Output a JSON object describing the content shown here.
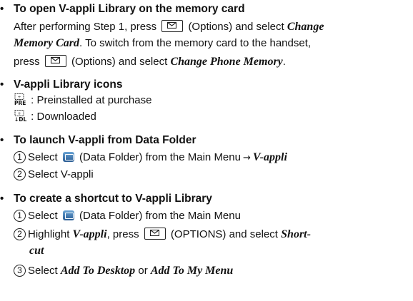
{
  "sections": [
    {
      "bullet": "•",
      "heading": "To open V-appli Library on the memory card",
      "lines": [
        {
          "a": "After performing Step 1, press",
          "b": "(Options) and select",
          "c": "Change"
        },
        {
          "a": "Memory Card",
          "b": ". To switch from the memory card to the handset,"
        },
        {
          "a": "press",
          "b": "(Options) and select",
          "c": "Change Phone Memory",
          "d": "."
        }
      ]
    },
    {
      "bullet": "•",
      "heading": "V-appli Library icons",
      "items": [
        {
          "icon": "preinstalled-icon",
          "badge": "PRE",
          "text": ": Preinstalled at purchase"
        },
        {
          "icon": "downloaded-icon",
          "badge": "↓DL",
          "text": ": Downloaded"
        }
      ]
    },
    {
      "bullet": "•",
      "heading": "To launch V-appli from Data Folder",
      "steps": [
        {
          "num": "1",
          "a": "Select",
          "b": "(Data Folder) from the Main Menu",
          "arrow": "→",
          "c": "V-appli"
        },
        {
          "num": "2",
          "a": "Select V-appli"
        }
      ]
    },
    {
      "bullet": "•",
      "heading": "To create a shortcut to V-appli Library",
      "steps": [
        {
          "num": "1",
          "a": "Select",
          "b": "(Data Folder) from the Main Menu"
        },
        {
          "num": "2",
          "a": "Highlight",
          "b": "V-appli",
          "c": ", press",
          "d": "(OPTIONS) and select",
          "e": "Short-",
          "f": "cut"
        },
        {
          "num": "3",
          "a": "Select",
          "b": "Add To Desktop",
          "c": "or",
          "d": "Add To My Menu"
        }
      ]
    }
  ],
  "icons": {
    "key": "mail-key-icon",
    "data_folder": "data-folder-icon"
  }
}
